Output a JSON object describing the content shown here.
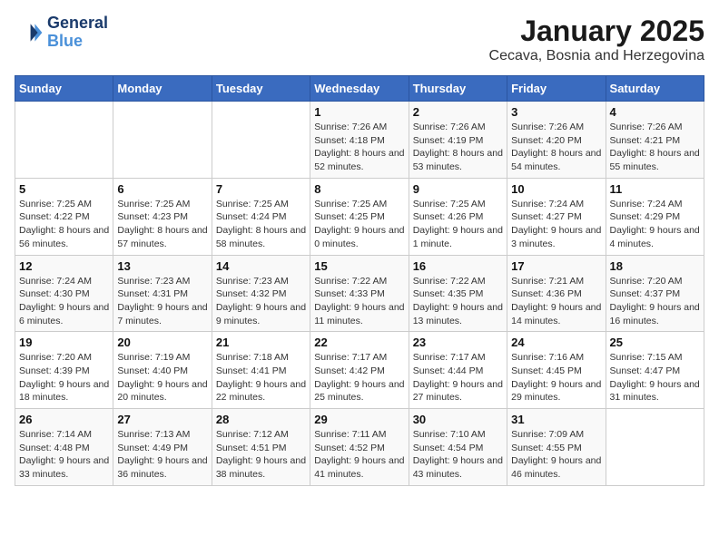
{
  "logo": {
    "line1": "General",
    "line2": "Blue"
  },
  "title": "January 2025",
  "subtitle": "Cecava, Bosnia and Herzegovina",
  "days_of_week": [
    "Sunday",
    "Monday",
    "Tuesday",
    "Wednesday",
    "Thursday",
    "Friday",
    "Saturday"
  ],
  "weeks": [
    [
      {
        "day": "",
        "info": ""
      },
      {
        "day": "",
        "info": ""
      },
      {
        "day": "",
        "info": ""
      },
      {
        "day": "1",
        "info": "Sunrise: 7:26 AM\nSunset: 4:18 PM\nDaylight: 8 hours and 52 minutes."
      },
      {
        "day": "2",
        "info": "Sunrise: 7:26 AM\nSunset: 4:19 PM\nDaylight: 8 hours and 53 minutes."
      },
      {
        "day": "3",
        "info": "Sunrise: 7:26 AM\nSunset: 4:20 PM\nDaylight: 8 hours and 54 minutes."
      },
      {
        "day": "4",
        "info": "Sunrise: 7:26 AM\nSunset: 4:21 PM\nDaylight: 8 hours and 55 minutes."
      }
    ],
    [
      {
        "day": "5",
        "info": "Sunrise: 7:25 AM\nSunset: 4:22 PM\nDaylight: 8 hours and 56 minutes."
      },
      {
        "day": "6",
        "info": "Sunrise: 7:25 AM\nSunset: 4:23 PM\nDaylight: 8 hours and 57 minutes."
      },
      {
        "day": "7",
        "info": "Sunrise: 7:25 AM\nSunset: 4:24 PM\nDaylight: 8 hours and 58 minutes."
      },
      {
        "day": "8",
        "info": "Sunrise: 7:25 AM\nSunset: 4:25 PM\nDaylight: 9 hours and 0 minutes."
      },
      {
        "day": "9",
        "info": "Sunrise: 7:25 AM\nSunset: 4:26 PM\nDaylight: 9 hours and 1 minute."
      },
      {
        "day": "10",
        "info": "Sunrise: 7:24 AM\nSunset: 4:27 PM\nDaylight: 9 hours and 3 minutes."
      },
      {
        "day": "11",
        "info": "Sunrise: 7:24 AM\nSunset: 4:29 PM\nDaylight: 9 hours and 4 minutes."
      }
    ],
    [
      {
        "day": "12",
        "info": "Sunrise: 7:24 AM\nSunset: 4:30 PM\nDaylight: 9 hours and 6 minutes."
      },
      {
        "day": "13",
        "info": "Sunrise: 7:23 AM\nSunset: 4:31 PM\nDaylight: 9 hours and 7 minutes."
      },
      {
        "day": "14",
        "info": "Sunrise: 7:23 AM\nSunset: 4:32 PM\nDaylight: 9 hours and 9 minutes."
      },
      {
        "day": "15",
        "info": "Sunrise: 7:22 AM\nSunset: 4:33 PM\nDaylight: 9 hours and 11 minutes."
      },
      {
        "day": "16",
        "info": "Sunrise: 7:22 AM\nSunset: 4:35 PM\nDaylight: 9 hours and 13 minutes."
      },
      {
        "day": "17",
        "info": "Sunrise: 7:21 AM\nSunset: 4:36 PM\nDaylight: 9 hours and 14 minutes."
      },
      {
        "day": "18",
        "info": "Sunrise: 7:20 AM\nSunset: 4:37 PM\nDaylight: 9 hours and 16 minutes."
      }
    ],
    [
      {
        "day": "19",
        "info": "Sunrise: 7:20 AM\nSunset: 4:39 PM\nDaylight: 9 hours and 18 minutes."
      },
      {
        "day": "20",
        "info": "Sunrise: 7:19 AM\nSunset: 4:40 PM\nDaylight: 9 hours and 20 minutes."
      },
      {
        "day": "21",
        "info": "Sunrise: 7:18 AM\nSunset: 4:41 PM\nDaylight: 9 hours and 22 minutes."
      },
      {
        "day": "22",
        "info": "Sunrise: 7:17 AM\nSunset: 4:42 PM\nDaylight: 9 hours and 25 minutes."
      },
      {
        "day": "23",
        "info": "Sunrise: 7:17 AM\nSunset: 4:44 PM\nDaylight: 9 hours and 27 minutes."
      },
      {
        "day": "24",
        "info": "Sunrise: 7:16 AM\nSunset: 4:45 PM\nDaylight: 9 hours and 29 minutes."
      },
      {
        "day": "25",
        "info": "Sunrise: 7:15 AM\nSunset: 4:47 PM\nDaylight: 9 hours and 31 minutes."
      }
    ],
    [
      {
        "day": "26",
        "info": "Sunrise: 7:14 AM\nSunset: 4:48 PM\nDaylight: 9 hours and 33 minutes."
      },
      {
        "day": "27",
        "info": "Sunrise: 7:13 AM\nSunset: 4:49 PM\nDaylight: 9 hours and 36 minutes."
      },
      {
        "day": "28",
        "info": "Sunrise: 7:12 AM\nSunset: 4:51 PM\nDaylight: 9 hours and 38 minutes."
      },
      {
        "day": "29",
        "info": "Sunrise: 7:11 AM\nSunset: 4:52 PM\nDaylight: 9 hours and 41 minutes."
      },
      {
        "day": "30",
        "info": "Sunrise: 7:10 AM\nSunset: 4:54 PM\nDaylight: 9 hours and 43 minutes."
      },
      {
        "day": "31",
        "info": "Sunrise: 7:09 AM\nSunset: 4:55 PM\nDaylight: 9 hours and 46 minutes."
      },
      {
        "day": "",
        "info": ""
      }
    ]
  ]
}
